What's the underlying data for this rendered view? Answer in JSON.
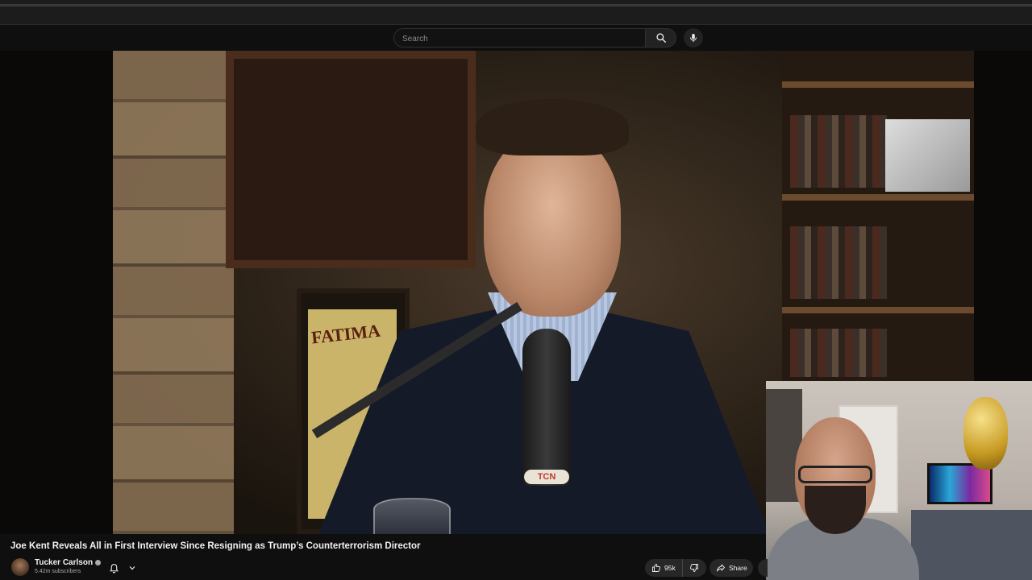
{
  "search": {
    "placeholder": "Search"
  },
  "video": {
    "title": "Joe Kent Reveals All in First Interview Since Resigning as Trump’s Counterterrorism Director",
    "poster_text": "FATIMA",
    "mic_badge": "TCN"
  },
  "channel": {
    "name": "Tucker Carlson",
    "subscribers": "5.42m subscribers"
  },
  "actions": {
    "like_count": "95k",
    "share_label": "Share"
  },
  "icons": {
    "search": "search-icon",
    "mic": "microphone-icon",
    "bell": "bell-icon",
    "chevron": "chevron-down-icon",
    "like": "thumbs-up-icon",
    "dislike": "thumbs-down-icon",
    "share": "share-arrow-icon"
  }
}
